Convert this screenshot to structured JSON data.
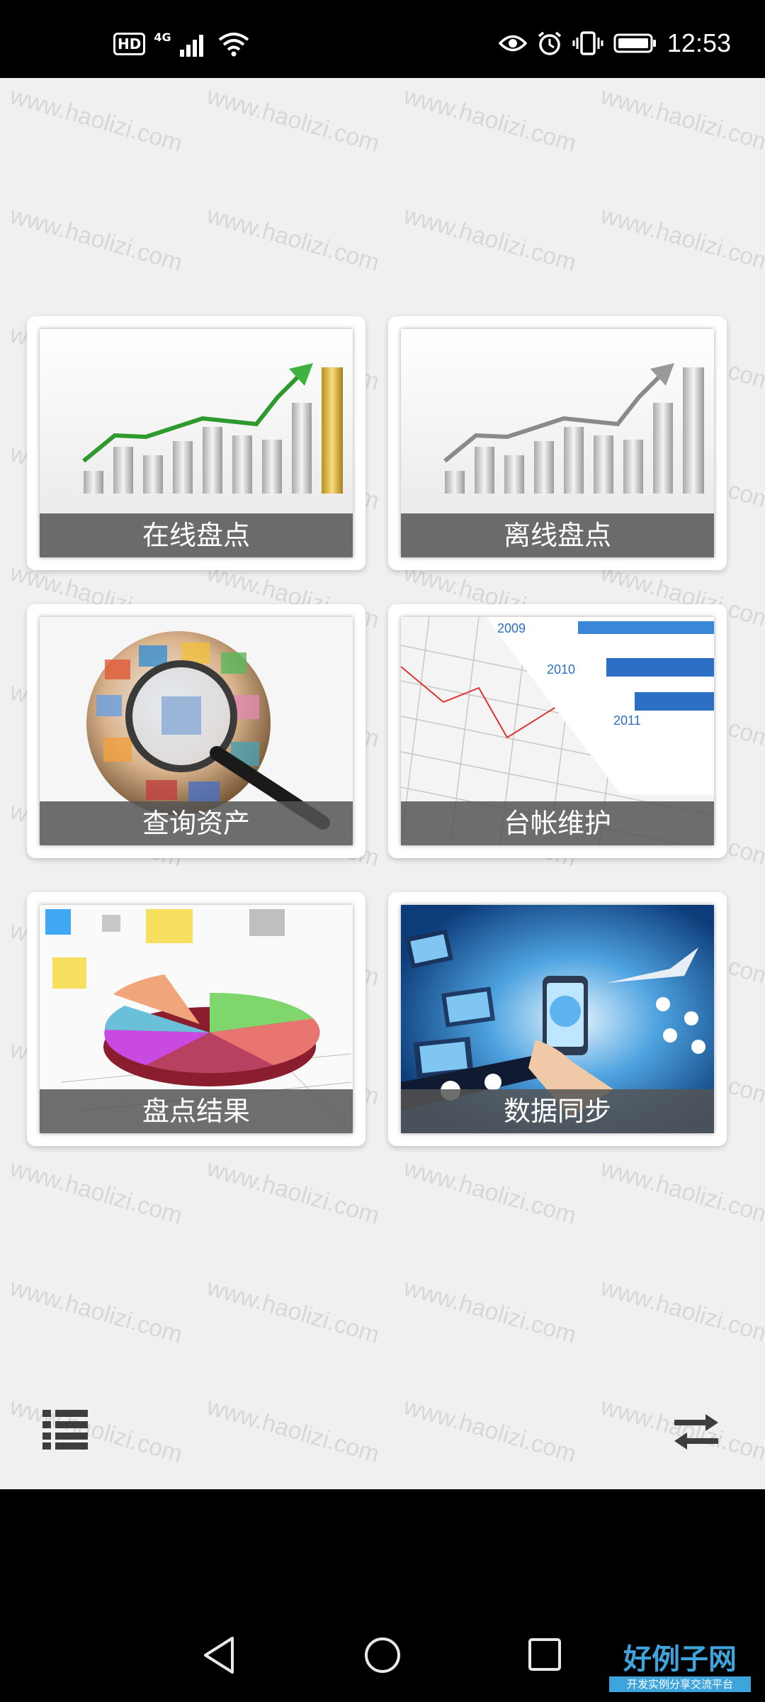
{
  "status_bar": {
    "hd_badge": "HD",
    "network": "4G",
    "time": "12:53",
    "icons": [
      "signal-icon",
      "wifi-icon",
      "eye-icon",
      "alarm-icon",
      "vibrate-icon",
      "battery-icon"
    ]
  },
  "watermark_text": "www.haolizi.com",
  "tiles": [
    {
      "label": "在线盘点",
      "icon": "bar-chart-gold-growth"
    },
    {
      "label": "离线盘点",
      "icon": "bar-chart-gray-growth"
    },
    {
      "label": "查询资产",
      "icon": "magnifier-globe"
    },
    {
      "label": "台帐维护",
      "icon": "ledger-bars-2009-2011"
    },
    {
      "label": "盘点结果",
      "icon": "pie-chart-3d"
    },
    {
      "label": "数据同步",
      "icon": "phone-media-stream"
    }
  ],
  "ledger_years": [
    "2009",
    "2010",
    "2011"
  ],
  "bottom_bar": {
    "left_icon": "list-icon",
    "right_icon": "swap-arrows-icon"
  },
  "nav_bar": {
    "icons": [
      "back-icon",
      "home-icon",
      "recents-icon"
    ]
  },
  "brand": {
    "name": "好例子网",
    "tagline": "开发实例分享交流平台"
  },
  "colors": {
    "accent": "#3ea4dc",
    "background": "#f0f0f0",
    "label_bar": "#555555"
  }
}
